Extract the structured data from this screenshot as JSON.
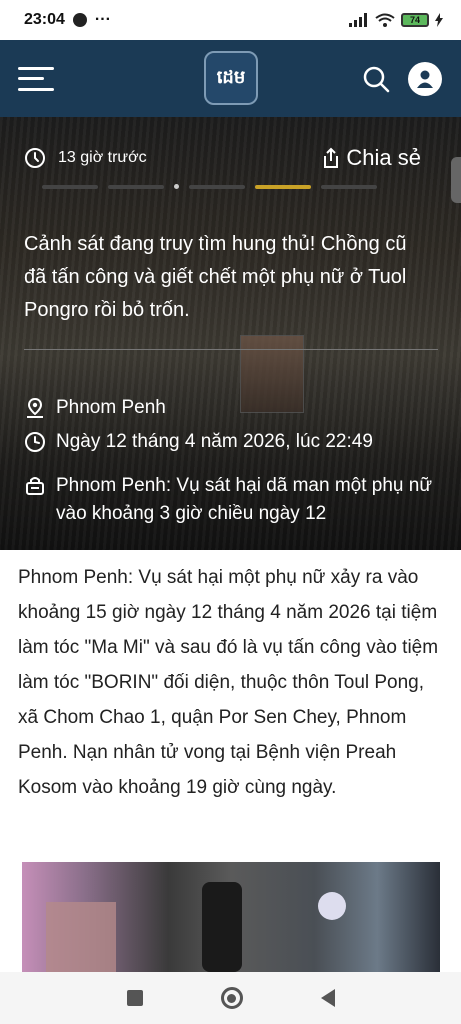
{
  "status_bar": {
    "time": "23:04",
    "dots": "···",
    "battery": "74"
  },
  "header": {
    "logo_text": "ដេម"
  },
  "hero": {
    "time_ago": "13 giờ trước",
    "share_label": "Chia sẻ",
    "headline": "Cảnh sát đang truy tìm hung thủ! Chồng cũ đã tấn công và giết chết một phụ nữ ở Tuol Pongro rồi bỏ trốn.",
    "location": "Phnom Penh",
    "datetime": "Ngày 12 tháng 4 năm 2026, lúc 22:49",
    "summary": "Phnom Penh: Vụ sát hại dã man một phụ nữ vào khoảng 3 giờ chiều ngày 12"
  },
  "article": {
    "body": "Phnom Penh: Vụ sát hại một phụ nữ xảy ra vào khoảng 15 giờ ngày 12 tháng 4 năm 2026 tại tiệm làm tóc \"Ma Mi\" và sau đó là vụ tấn công vào tiệm làm tóc \"BORIN\" đối diện, thuộc thôn Toul Pong, xã Chom Chao 1, quận Por Sen Chey, Phnom Penh. Nạn nhân tử vong tại Bệnh viện Preah Kosom vào khoảng 19 giờ cùng ngày."
  },
  "colors": {
    "header_bg": "#1b3a55",
    "accent": "#c9a227"
  },
  "icons": [
    "messenger-icon",
    "signal-icon",
    "wifi-icon",
    "battery-icon",
    "menu-icon",
    "search-icon",
    "user-icon",
    "clock-icon",
    "share-icon",
    "location-pin-icon",
    "summary-icon"
  ]
}
